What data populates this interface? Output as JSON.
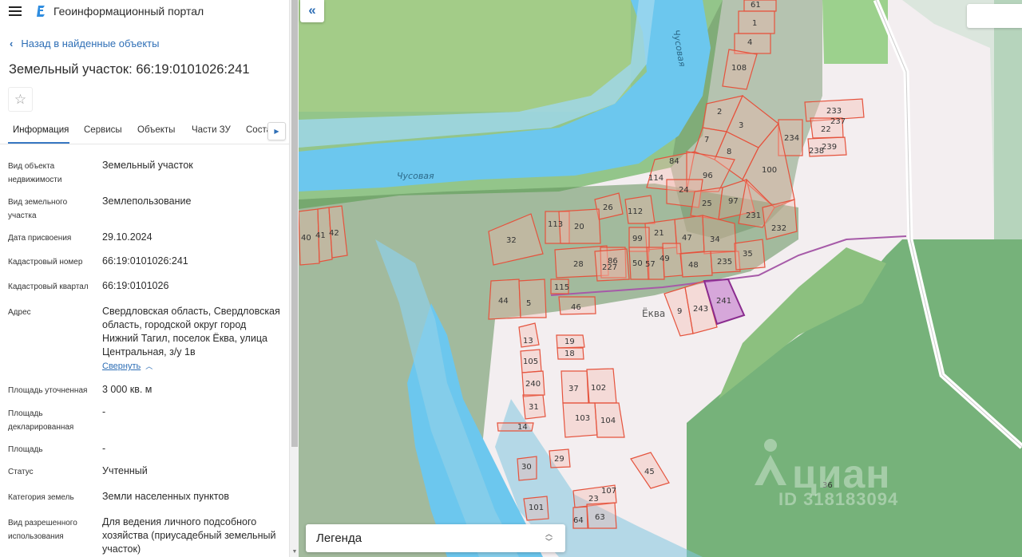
{
  "app": {
    "title": "Геоинформационный портал"
  },
  "nav": {
    "back_label": "Назад в найденные объекты",
    "back_icon": "chevron-left-icon"
  },
  "object": {
    "title": "Земельный участок: 66:19:0101026:241"
  },
  "tabs": [
    {
      "label": "Информация",
      "active": true
    },
    {
      "label": "Сервисы"
    },
    {
      "label": "Объекты"
    },
    {
      "label": "Части ЗУ"
    },
    {
      "label": "Соста"
    }
  ],
  "details": {
    "rows": [
      {
        "label": "Вид объекта недвижимости",
        "value": "Земельный участок"
      },
      {
        "label": "Вид земельного участка",
        "value": "Землепользование"
      },
      {
        "label": "Дата присвоения",
        "value": "29.10.2024"
      },
      {
        "label": "Кадастровый номер",
        "value": "66:19:0101026:241"
      },
      {
        "label": "Кадастровый квартал",
        "value": "66:19:0101026"
      },
      {
        "label": "Адрес",
        "value": "Свердловская область, Свердловская область, городской округ город Нижний Тагил, поселок Ёква, улица Центральная, з/у 1в"
      },
      {
        "label": "Площадь уточненная",
        "value": "3 000 кв. м"
      },
      {
        "label": "Площадь декларированная",
        "value": "-"
      },
      {
        "label": "Площадь",
        "value": "-"
      },
      {
        "label": "Статус",
        "value": "Учтенный"
      },
      {
        "label": "Категория земель",
        "value": "Земли населенных пунктов"
      },
      {
        "label": "Вид разрешенного использования",
        "value": "Для ведения личного подсобного хозяйства (приусадебный земельный участок)"
      }
    ],
    "collapse_label": "Свернуть"
  },
  "map": {
    "legend_label": "Легенда",
    "river_labels": [
      "Чусовая",
      "Чусовая"
    ],
    "place_label": "Ёква",
    "watermark": {
      "brand": "циан",
      "id": "ID 318183094"
    },
    "colors": {
      "parcel": "#e5533d",
      "selected": "#8a2c8f",
      "river": "#6cc7ee",
      "forest": "#8fc383"
    },
    "parcels": [
      "61",
      "1",
      "4",
      "108",
      "233",
      "237",
      "22",
      "238",
      "239",
      "234",
      "2",
      "3",
      "7",
      "8",
      "100",
      "84",
      "114",
      "96",
      "24",
      "25",
      "97",
      "231",
      "232",
      "26",
      "112",
      "113",
      "20",
      "21",
      "47",
      "34",
      "99",
      "40",
      "41",
      "42",
      "32",
      "28",
      "86",
      "227",
      "50",
      "57",
      "49",
      "48",
      "235",
      "35",
      "115",
      "44",
      "5",
      "46",
      "9",
      "243",
      "241",
      "13",
      "19",
      "18",
      "105",
      "240",
      "37",
      "102",
      "31",
      "103",
      "104",
      "14",
      "29",
      "30",
      "45",
      "107",
      "23",
      "101",
      "64",
      "63",
      "36"
    ]
  }
}
